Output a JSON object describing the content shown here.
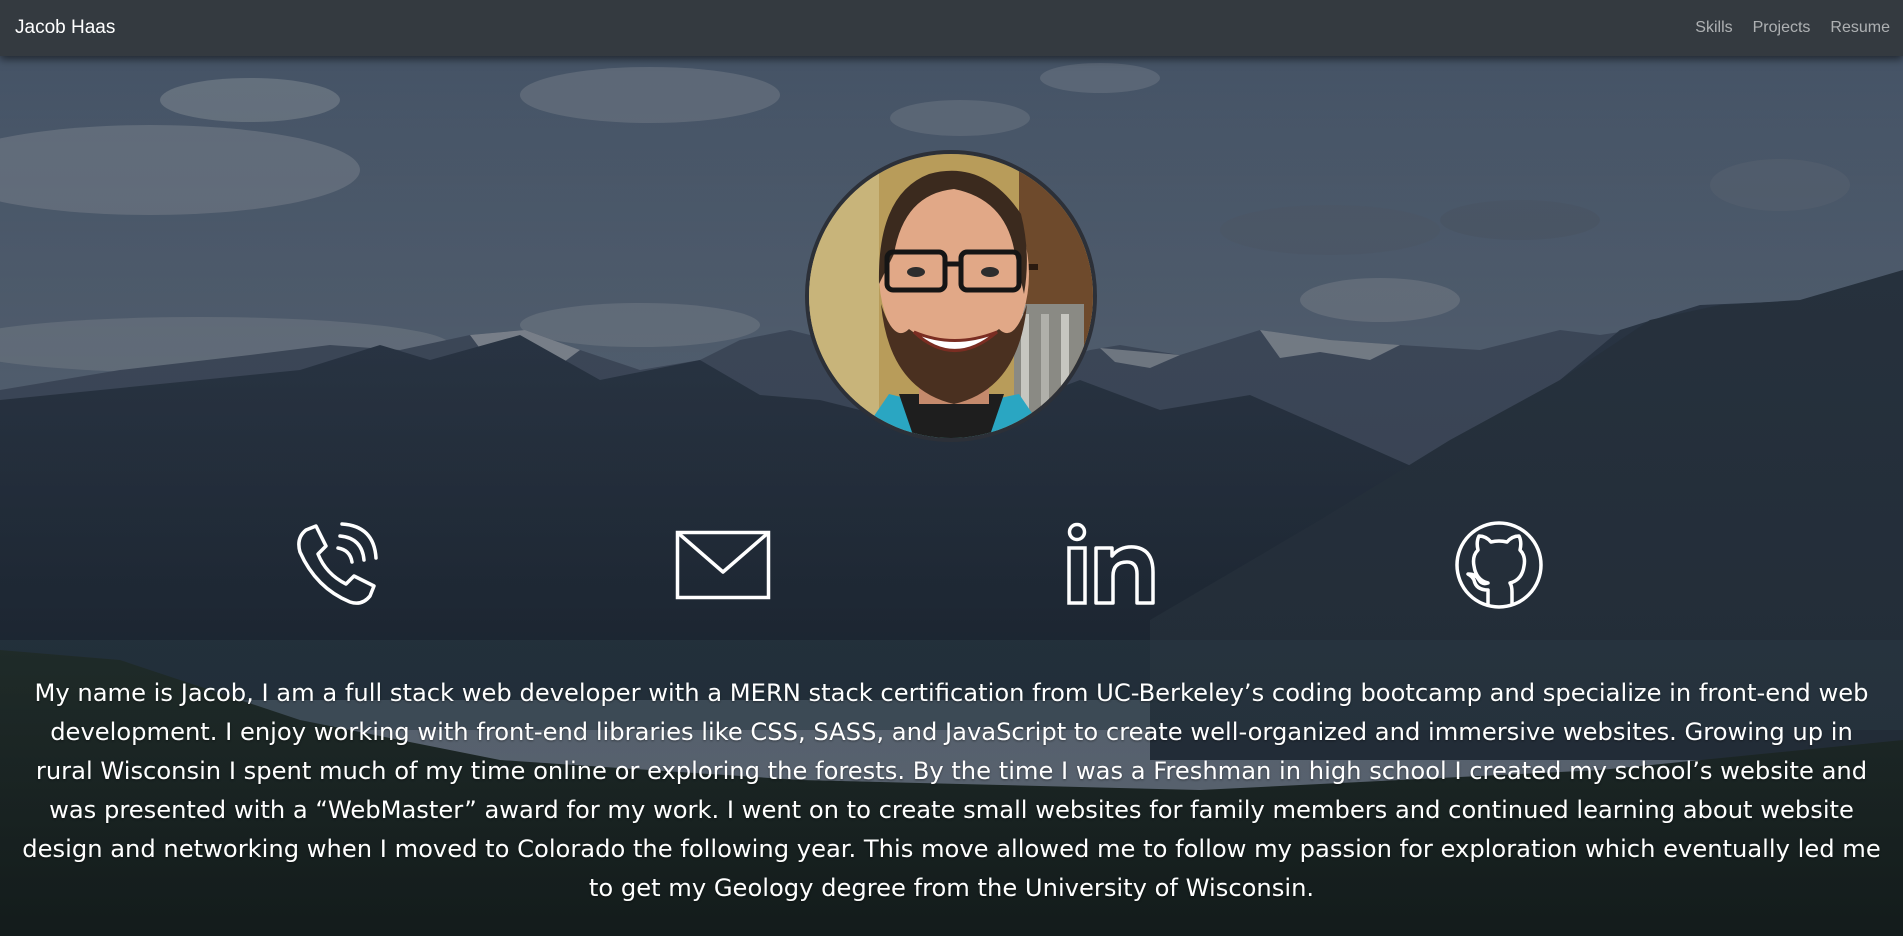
{
  "navbar": {
    "brand": "Jacob Haas",
    "links": [
      {
        "label": "Skills"
      },
      {
        "label": "Projects"
      },
      {
        "label": "Resume"
      }
    ]
  },
  "profile": {
    "photo_icon": "profile-photo"
  },
  "contacts": [
    {
      "icon": "phone-icon"
    },
    {
      "icon": "envelope-icon"
    },
    {
      "icon": "linkedin-icon"
    },
    {
      "icon": "github-icon"
    }
  ],
  "bio": {
    "text": "My name is Jacob, I am a full stack web developer with a MERN stack certification from UC-Berkeley’s coding bootcamp and specialize in front-end web development. I enjoy working with front-end libraries like CSS, SASS, and JavaScript to create well-organized and immersive websites. Growing up in rural Wisconsin I spent much of my time online or exploring the forests. By the time I was a Freshman in high school I created my school’s website and was presented with a “WebMaster” award for my work. I went on to create small websites for family members and continued learning about website design and networking when I moved to Colorado the following year. This move allowed me to follow my passion for exploration which eventually led me to get my Geology degree from the University of Wisconsin."
  },
  "colors": {
    "navbar_bg": "#343a40",
    "icon_stroke": "#ffffff",
    "text": "#ffffff"
  }
}
